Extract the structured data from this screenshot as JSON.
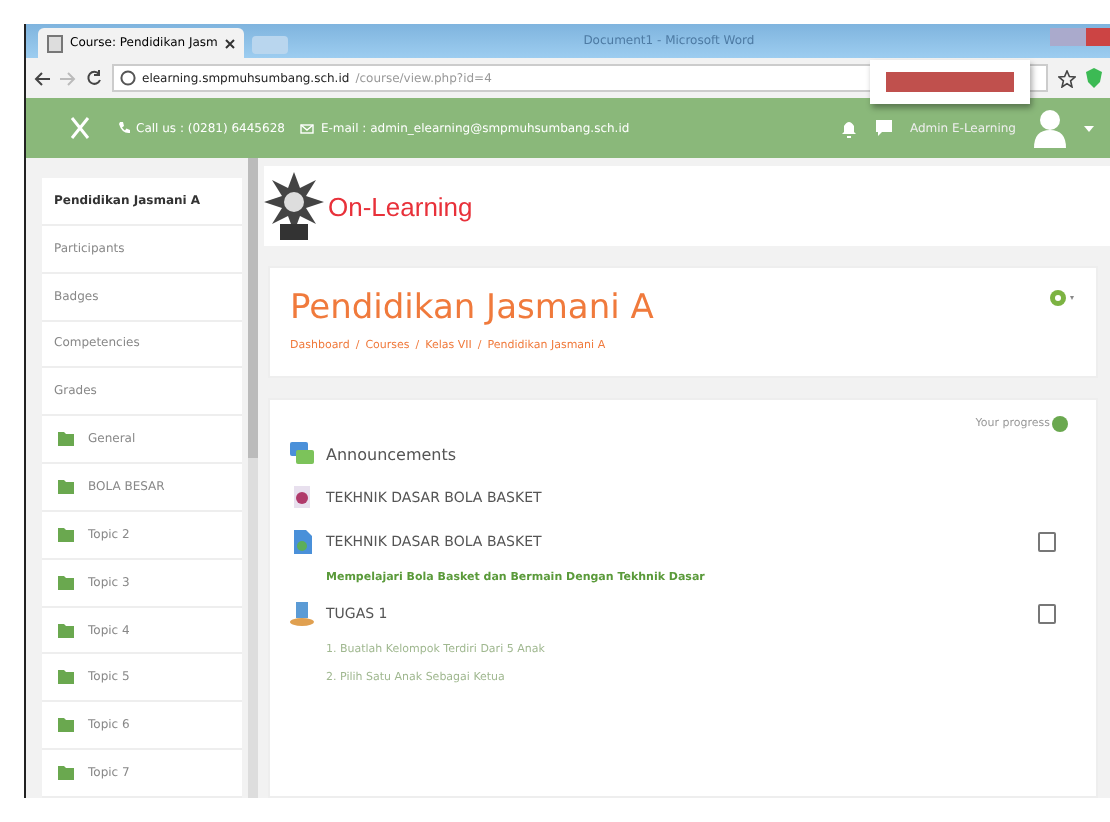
{
  "browser": {
    "tab_title": "Course: Pendidikan Jasm",
    "window_title": "Document1 - Microsoft Word",
    "url_host": "elearning.smpmuhsumbang.sch.id",
    "url_path": "/course/view.php?id=4"
  },
  "navbar": {
    "phone": "Call us : (0281) 6445628",
    "email": "E-mail : admin_elearning@smpmuhsumbang.sch.id",
    "user": "Admin E-Learning"
  },
  "sidebar": {
    "items": [
      {
        "label": "Pendidikan Jasmani A",
        "kind": "heading"
      },
      {
        "label": "Participants",
        "kind": "link"
      },
      {
        "label": "Badges",
        "kind": "link"
      },
      {
        "label": "Competencies",
        "kind": "link"
      },
      {
        "label": "Grades",
        "kind": "link"
      },
      {
        "label": "General",
        "kind": "section"
      },
      {
        "label": "BOLA BESAR",
        "kind": "section"
      },
      {
        "label": "Topic 2",
        "kind": "section"
      },
      {
        "label": "Topic 3",
        "kind": "section"
      },
      {
        "label": "Topic 4",
        "kind": "section"
      },
      {
        "label": "Topic 5",
        "kind": "section"
      },
      {
        "label": "Topic 6",
        "kind": "section"
      },
      {
        "label": "Topic 7",
        "kind": "section"
      }
    ]
  },
  "logo": {
    "text": "On-Learning"
  },
  "course": {
    "title": "Pendidikan Jasmani A",
    "breadcrumb": [
      "Dashboard",
      "Courses",
      "Kelas VII",
      "Pendidikan Jasmani A"
    ],
    "separator": "/"
  },
  "content": {
    "progress_label": "Your progress",
    "activities": [
      {
        "name": "Announcements",
        "kind": "forum"
      },
      {
        "name": "TEKHNIK DASAR BOLA BASKET",
        "kind": "page"
      },
      {
        "name": "TEKHNIK DASAR BOLA BASKET",
        "kind": "file",
        "completion": false,
        "description": [
          "Mempelajari Bola Basket dan Bermain Dengan Tekhnik Dasar"
        ],
        "description_link": true
      },
      {
        "name": "TUGAS 1",
        "kind": "assign",
        "completion": false,
        "description": [
          "1. Buatlah Kelompok Terdiri Dari 5 Anak",
          "2. Pilih Satu Anak Sebagai Ketua"
        ],
        "description_link": false
      }
    ]
  }
}
